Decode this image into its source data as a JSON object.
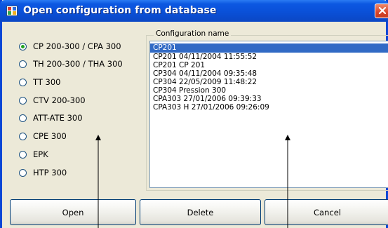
{
  "window": {
    "title": "Open configuration from database"
  },
  "radio_options": [
    {
      "label": "CP 200-300 / CPA 300",
      "checked": true
    },
    {
      "label": "TH 200-300 / THA 300",
      "checked": false
    },
    {
      "label": "TT 300",
      "checked": false
    },
    {
      "label": "CTV 200-300",
      "checked": false
    },
    {
      "label": "ATT-ATE 300",
      "checked": false
    },
    {
      "label": "CPE 300",
      "checked": false
    },
    {
      "label": "EPK",
      "checked": false
    },
    {
      "label": "HTP 300",
      "checked": false
    }
  ],
  "config_list": {
    "legend": "Configuration name",
    "items": [
      "CP201",
      "CP201 04/11/2004 11:55:52",
      "CP201 CP 201",
      "CP304 04/11/2004 09:35:48",
      "CP304 22/05/2009 11:48:22",
      "CP304 Pression 300",
      "CPA303 27/01/2006 09:39:33",
      "CPA303 H 27/01/2006 09:26:09"
    ],
    "selected_index": 0
  },
  "buttons": {
    "open": "Open",
    "delete": "Delete",
    "cancel": "Cancel"
  },
  "colors": {
    "title_bar": "#0a50d8",
    "selection": "#316ac5",
    "radio_dot": "#21a121",
    "annotation_arrow": "#000000"
  },
  "icons": {
    "app": "database-window-icon",
    "close": "close-x-icon",
    "annotation": "arrow-up-icon"
  }
}
